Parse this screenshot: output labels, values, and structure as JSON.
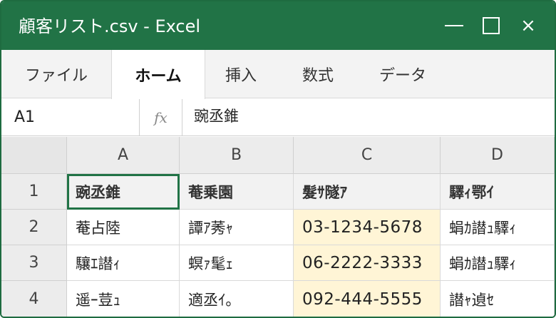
{
  "window": {
    "title": "顧客リスト.csv - Excel",
    "controls": {
      "minimize": "—",
      "maximize": "☐",
      "close": "×"
    }
  },
  "ribbon": {
    "tabs": [
      {
        "label": "ファイル",
        "active": false
      },
      {
        "label": "ホーム",
        "active": true
      },
      {
        "label": "挿入",
        "active": false
      },
      {
        "label": "数式",
        "active": false
      },
      {
        "label": "データ",
        "active": false
      }
    ]
  },
  "formula_bar": {
    "name_box": "A1",
    "fx_label": "fx",
    "value": "豌丞錐"
  },
  "sheet": {
    "columns": [
      "A",
      "B",
      "C",
      "D"
    ],
    "rows": [
      {
        "num": "1",
        "cells": [
          "豌丞錐",
          "菴乗園",
          "髮ｻ隧ｱ",
          "驛ｨ鄂ｲ"
        ]
      },
      {
        "num": "2",
        "cells": [
          "菴占陸",
          "譚ｱ莠ｬ",
          "03-1234-5678",
          "蜎ｶ譛ｭ驛ｨ"
        ]
      },
      {
        "num": "3",
        "cells": [
          "驤ｴ譛ｨ",
          "螟ｧ髦ｪ",
          "06-2222-3333",
          "蜎ｶ譛ｭ驛ｨ"
        ]
      },
      {
        "num": "4",
        "cells": [
          "遥ｰ荳ｭ",
          "適丞ｲ｡",
          "092-444-5555",
          "譛ｬ遉ｾ"
        ]
      }
    ],
    "selected_cell": "A1",
    "colors": {
      "accent": "#217346",
      "phone_fill": "#fff5d6"
    }
  }
}
